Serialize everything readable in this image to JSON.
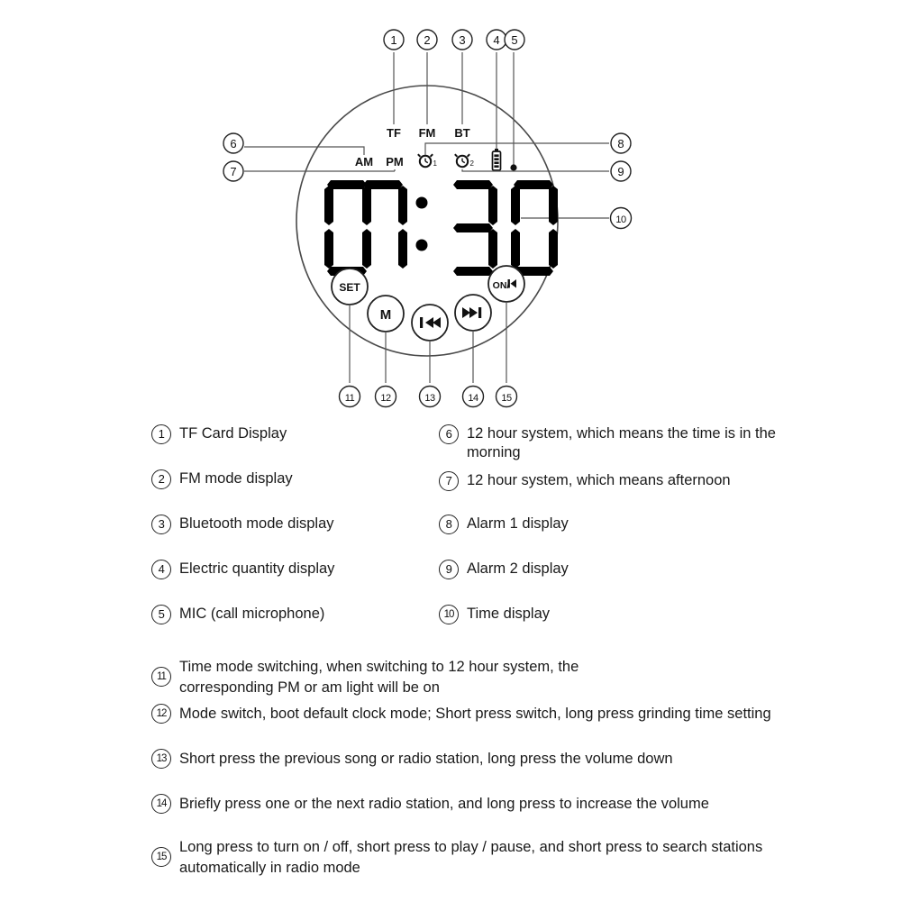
{
  "device": {
    "display": {
      "time": "07:30",
      "hour": "07",
      "minute": "30",
      "separator": ":",
      "indicators": [
        {
          "id": "tf",
          "label": "TF",
          "name": "tf-indicator"
        },
        {
          "id": "fm",
          "label": "FM",
          "name": "fm-indicator"
        },
        {
          "id": "bt",
          "label": "BT",
          "name": "bt-indicator"
        }
      ],
      "meridiem": [
        {
          "id": "am",
          "label": "AM",
          "name": "am-indicator"
        },
        {
          "id": "pm",
          "label": "PM",
          "name": "pm-indicator"
        }
      ],
      "alarms": [
        {
          "id": "alarm1",
          "label": "1",
          "name": "alarm-1-icon"
        },
        {
          "id": "alarm2",
          "label": "2",
          "name": "alarm-2-icon"
        }
      ],
      "battery_icon": "battery-icon",
      "mic_icon": "mic-dot-icon"
    },
    "buttons": [
      {
        "id": "set",
        "label": "SET",
        "name": "set-button",
        "callout": "11"
      },
      {
        "id": "mode",
        "label": "M",
        "name": "mode-button",
        "callout": "12"
      },
      {
        "id": "prev",
        "label": "prev-track-icon",
        "name": "previous-button",
        "callout": "13"
      },
      {
        "id": "next",
        "label": "next-track-icon",
        "name": "next-button",
        "callout": "14"
      },
      {
        "id": "onplay",
        "label": "ON/",
        "name": "power-play-button",
        "callout": "15"
      }
    ]
  },
  "callouts": {
    "top": [
      "1",
      "2",
      "3",
      "4",
      "5"
    ],
    "left": [
      "6",
      "7"
    ],
    "right": [
      "8",
      "9",
      "10"
    ],
    "bottom": [
      "11",
      "12",
      "13",
      "14",
      "15"
    ]
  },
  "legend": {
    "left_column": [
      {
        "num": "1",
        "text": "TF Card Display"
      },
      {
        "num": "2",
        "text": "FM mode display"
      },
      {
        "num": "3",
        "text": "Bluetooth mode display"
      },
      {
        "num": "4",
        "text": "Electric quantity display"
      },
      {
        "num": "5",
        "text": "MIC (call microphone)"
      }
    ],
    "right_column": [
      {
        "num": "6",
        "text": "12 hour system, which means the time is in the morning"
      },
      {
        "num": "7",
        "text": "12 hour system, which means afternoon"
      },
      {
        "num": "8",
        "text": "Alarm 1 display"
      },
      {
        "num": "9",
        "text": "Alarm 2 display"
      },
      {
        "num": "10",
        "text": "Time display"
      }
    ],
    "wide_rows": [
      {
        "num": "11",
        "text": "Time mode switching, when switching to 12 hour system, the corresponding PM or am light will be on"
      },
      {
        "num": "12",
        "text": "Mode switch, boot default clock mode; Short press switch, long press grinding time setting"
      },
      {
        "num": "13",
        "text": "Short press the previous song or radio station, long press the volume down"
      },
      {
        "num": "14",
        "text": "Briefly press one or the next radio station, and long press to increase the volume"
      },
      {
        "num": "15",
        "text": "Long press to turn on / off, short press to play / pause, and short press to search stations automatically in radio mode"
      }
    ]
  },
  "colors": {
    "background": "#ffffff",
    "ink": "#1a1a1a",
    "line": "#555555",
    "segment": "#000000"
  }
}
